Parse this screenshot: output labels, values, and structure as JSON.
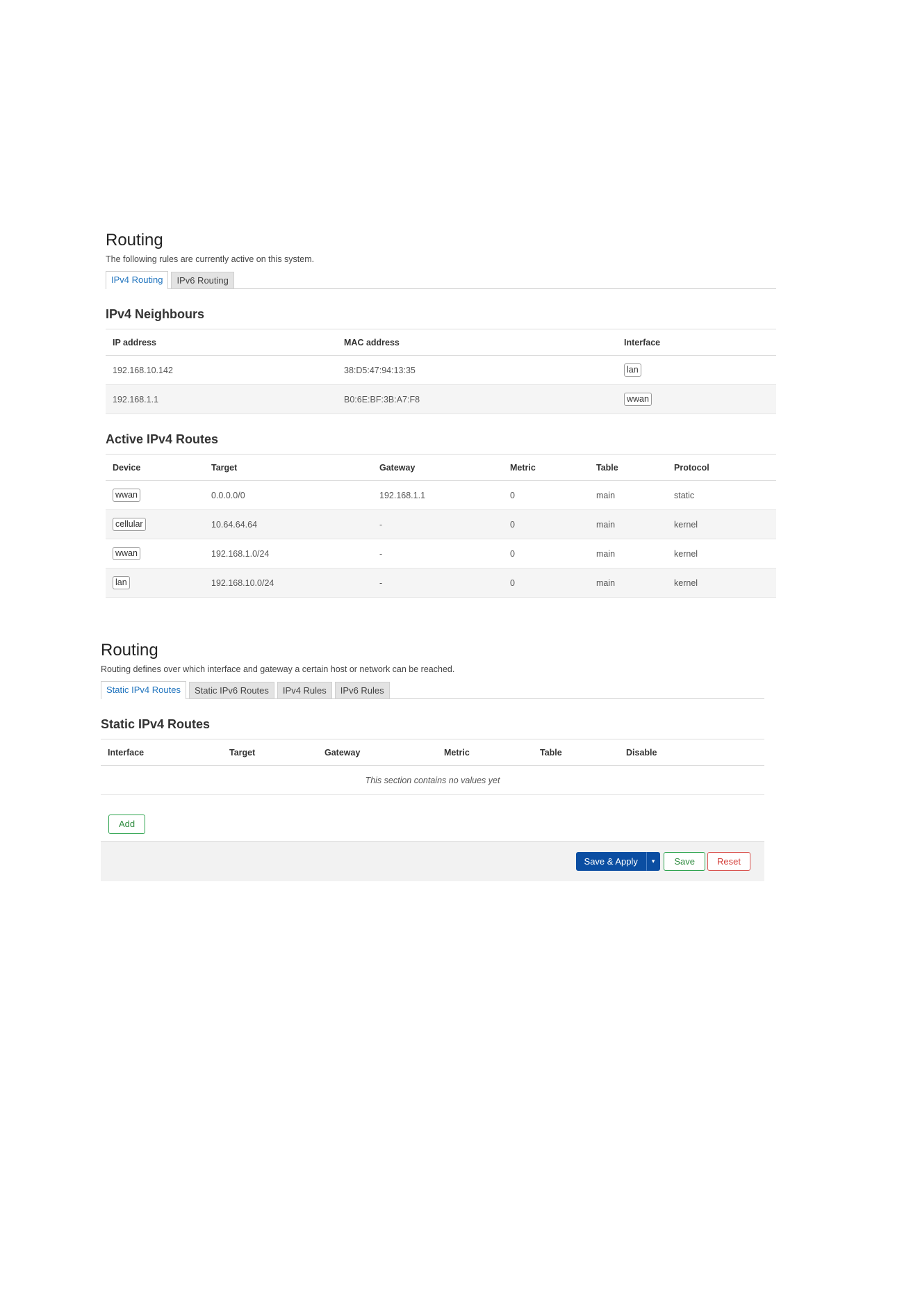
{
  "status": {
    "title": "Routing",
    "description": "The following rules are currently active on this system.",
    "tabs": [
      {
        "label": "IPv4 Routing",
        "active": true
      },
      {
        "label": "IPv6 Routing",
        "active": false
      }
    ],
    "neighbours": {
      "title": "IPv4 Neighbours",
      "columns": [
        "IP address",
        "MAC address",
        "Interface"
      ],
      "rows": [
        {
          "ip": "192.168.10.142",
          "mac": "38:D5:47:94:13:35",
          "iface": "lan"
        },
        {
          "ip": "192.168.1.1",
          "mac": "B0:6E:BF:3B:A7:F8",
          "iface": "wwan"
        }
      ]
    },
    "routes": {
      "title": "Active IPv4 Routes",
      "columns": [
        "Device",
        "Target",
        "Gateway",
        "Metric",
        "Table",
        "Protocol"
      ],
      "rows": [
        {
          "device": "wwan",
          "target": "0.0.0.0/0",
          "gateway": "192.168.1.1",
          "metric": "0",
          "table": "main",
          "protocol": "static"
        },
        {
          "device": "cellular",
          "target": "10.64.64.64",
          "gateway": "-",
          "metric": "0",
          "table": "main",
          "protocol": "kernel"
        },
        {
          "device": "wwan",
          "target": "192.168.1.0/24",
          "gateway": "-",
          "metric": "0",
          "table": "main",
          "protocol": "kernel"
        },
        {
          "device": "lan",
          "target": "192.168.10.0/24",
          "gateway": "-",
          "metric": "0",
          "table": "main",
          "protocol": "kernel"
        }
      ]
    }
  },
  "config": {
    "title": "Routing",
    "description": "Routing defines over which interface and gateway a certain host or network can be reached.",
    "tabs": [
      {
        "label": "Static IPv4 Routes",
        "active": true
      },
      {
        "label": "Static IPv6 Routes",
        "active": false
      },
      {
        "label": "IPv4 Rules",
        "active": false
      },
      {
        "label": "IPv6 Rules",
        "active": false
      }
    ],
    "static_routes": {
      "title": "Static IPv4 Routes",
      "columns": [
        "Interface",
        "Target",
        "Gateway",
        "Metric",
        "Table",
        "Disable"
      ],
      "empty_text": "This section contains no values yet"
    },
    "add_label": "Add",
    "actions": {
      "save_apply": "Save & Apply",
      "dropdown_glyph": "▾",
      "save": "Save",
      "reset": "Reset"
    }
  },
  "colors": {
    "accent": "#1e73be",
    "primary_button": "#0b4ea2",
    "positive": "#2ea44f",
    "negative": "#d9534f"
  }
}
